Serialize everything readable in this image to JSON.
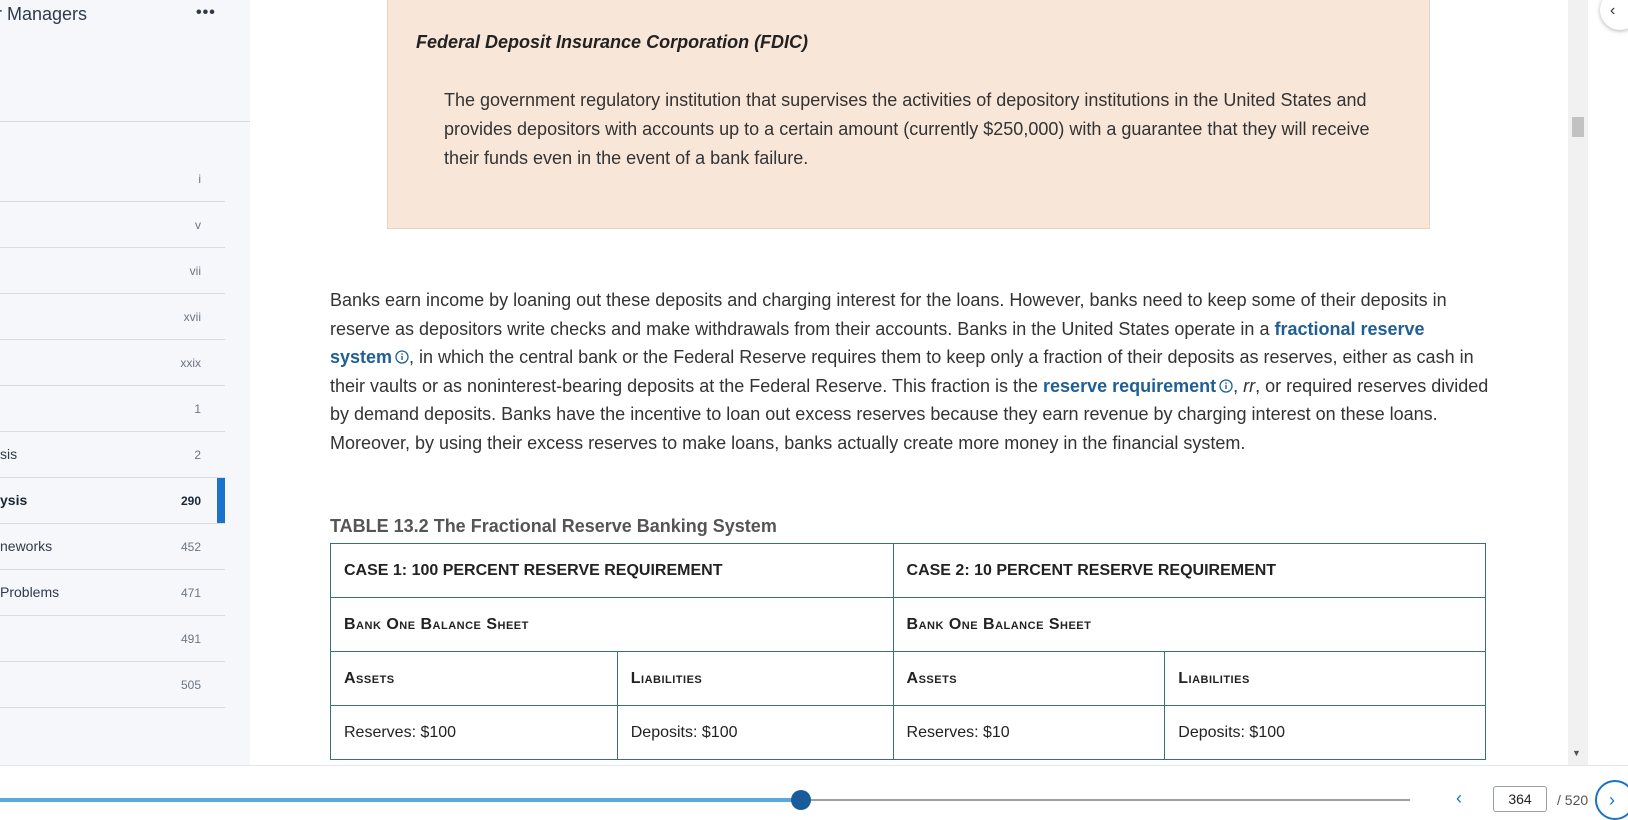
{
  "sidebar": {
    "title": "r Managers",
    "more_label": "•••",
    "toc": [
      {
        "label": "",
        "page": "i"
      },
      {
        "label": "",
        "page": "v"
      },
      {
        "label": "",
        "page": "vii"
      },
      {
        "label": "",
        "page": "xvii"
      },
      {
        "label": "",
        "page": "xxix"
      },
      {
        "label": "",
        "page": "1"
      },
      {
        "label": "sis",
        "page": "2"
      },
      {
        "label": "ysis",
        "page": "290",
        "active": true
      },
      {
        "label": "neworks",
        "page": "452"
      },
      {
        "label": " Problems",
        "page": "471"
      },
      {
        "label": "",
        "page": "491"
      },
      {
        "label": "",
        "page": "505"
      }
    ]
  },
  "content": {
    "callout": {
      "term": "Federal Deposit Insurance Corporation (FDIC)",
      "definition": "The government regulatory institution that supervises the activities of depository institutions in the United States and provides depositors with accounts up to a certain amount (currently $250,000) with a guarantee that they will receive their funds even in the event of a bank failure."
    },
    "paragraph": {
      "part1": "Banks earn income by loaning out these deposits and charging interest for the loans. However, banks need to keep some of their deposits in reserve as depositors write checks and make withdrawals from their accounts. Banks in the United States operate in a ",
      "kw1": "fractional reserve system",
      "part2": ", in which the central bank or the Federal Reserve requires them to keep only a fraction of their deposits as reserves, either as cash in their vaults or as noninterest-bearing deposits at the Federal Reserve. This fraction is the ",
      "kw2": "reserve requirement",
      "part3": ", ",
      "rr": "rr",
      "part4": ", or required reserves divided by demand deposits. Banks have the incentive to loan out excess reserves because they earn revenue by charging interest on these loans. Moreover, by using their excess reserves to make loans, banks actually create more money in the financial system."
    },
    "table": {
      "caption": "TABLE 13.2 The Fractional Reserve Banking System",
      "case1": "CASE 1: 100 PERCENT RESERVE REQUIREMENT",
      "case2": "CASE 2: 10 PERCENT RESERVE REQUIREMENT",
      "sheet1": "Bank One Balance Sheet",
      "sheet2": "Bank One Balance Sheet",
      "assets1": "Assets",
      "liabilities1": "Liabilities",
      "assets2": "Assets",
      "liabilities2": "Liabilities",
      "reserves1": "Reserves: $100",
      "deposits1": "Deposits: $100",
      "reserves2": "Reserves: $10",
      "deposits2": "Deposits: $100"
    }
  },
  "navigation": {
    "current_page": "364",
    "total_pages": "/ 520",
    "progress": 0.5683,
    "prev_icon": "chevron-left-icon",
    "next_icon": "chevron-right-icon"
  },
  "colors": {
    "accent": "#1a73c9",
    "callout_bg": "#f8e6d9",
    "keyword": "#1f5f95",
    "table_border": "#3a7078"
  }
}
